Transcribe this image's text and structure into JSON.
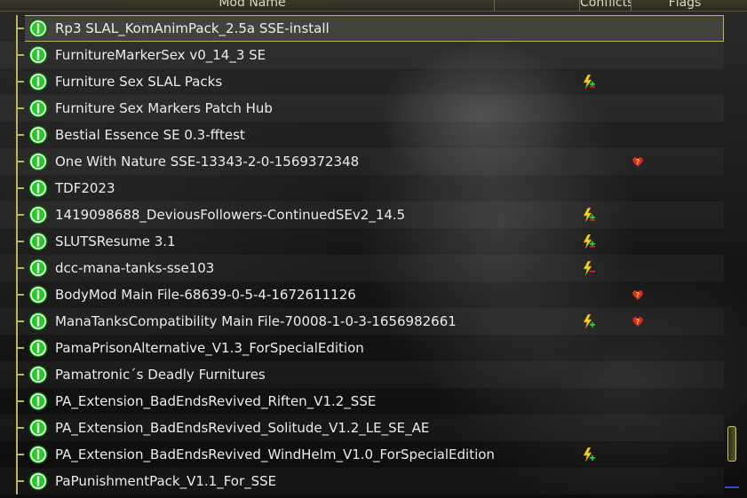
{
  "header": {
    "columns": [
      {
        "id": "mod_name",
        "label": "Mod Name"
      },
      {
        "id": "blank",
        "label": ""
      },
      {
        "id": "conflicts",
        "label": "Conflicts"
      },
      {
        "id": "flags",
        "label": "Flags"
      }
    ]
  },
  "colors": {
    "enabled_icon": "#22cc22",
    "tree_line": "#b8b85a",
    "selection_border": "#b8b85a"
  },
  "mods": [
    {
      "name": "Rp3 SLAL_KomAnimPack_2.5a SSE-install",
      "enabled": true,
      "selected": true,
      "conflict": "",
      "flag": ""
    },
    {
      "name": "FurnitureMarkerSex v0_14_3 SE",
      "enabled": true,
      "conflict": "",
      "flag": ""
    },
    {
      "name": "Furniture Sex SLAL Packs",
      "enabled": true,
      "conflict": "overwrites-and-overwritten-icon",
      "flag": ""
    },
    {
      "name": "Furniture Sex Markers Patch Hub",
      "enabled": true,
      "conflict": "",
      "flag": ""
    },
    {
      "name": "Bestial Essence SE 0.3-fftest",
      "enabled": true,
      "conflict": "",
      "flag": ""
    },
    {
      "name": "One With Nature SSE-13343-2-0-1569372348",
      "enabled": true,
      "conflict": "",
      "flag": "problem-heart-icon"
    },
    {
      "name": "TDF2023",
      "enabled": true,
      "conflict": "",
      "flag": ""
    },
    {
      "name": "1419098688_DeviousFollowers-ContinuedSEv2_14.5",
      "enabled": true,
      "conflict": "overwrites-and-overwritten-icon",
      "flag": ""
    },
    {
      "name": "SLUTSResume 3.1",
      "enabled": true,
      "conflict": "overwrites-and-overwritten-icon",
      "flag": ""
    },
    {
      "name": "dcc-mana-tanks-sse103",
      "enabled": true,
      "conflict": "overwritten-icon",
      "flag": ""
    },
    {
      "name": "BodyMod Main File-68639-0-5-4-1672611126",
      "enabled": true,
      "conflict": "",
      "flag": "problem-heart-icon"
    },
    {
      "name": "ManaTanksCompatibility Main File-70008-1-0-3-1656982661",
      "enabled": true,
      "conflict": "overwrites-icon",
      "flag": "problem-heart-icon"
    },
    {
      "name": "PamaPrisonAlternative_V1.3_ForSpecialEdition",
      "enabled": true,
      "conflict": "",
      "flag": ""
    },
    {
      "name": "Pamatronic´s Deadly Furnitures",
      "enabled": true,
      "conflict": "",
      "flag": ""
    },
    {
      "name": "PA_Extension_BadEndsRevived_Riften_V1.2_SSE",
      "enabled": true,
      "conflict": "",
      "flag": ""
    },
    {
      "name": "PA_Extension_BadEndsRevived_Solitude_V1.2_LE_SE_AE",
      "enabled": true,
      "conflict": "",
      "flag": ""
    },
    {
      "name": "PA_Extension_BadEndsRevived_WindHelm_V1.0_ForSpecialEdition",
      "enabled": true,
      "conflict": "overwrites-icon",
      "flag": ""
    },
    {
      "name": "PaPunishmentPack_V1.1_For_SSE",
      "enabled": true,
      "conflict": "",
      "flag": ""
    }
  ]
}
